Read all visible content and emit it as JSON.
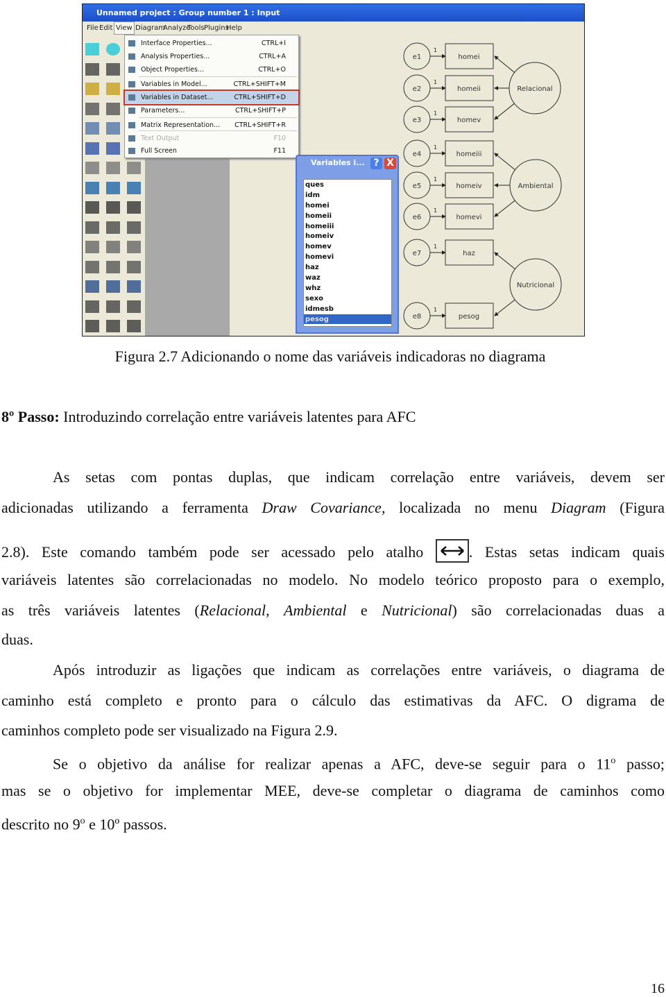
{
  "screenshot": {
    "window_title": "Unnamed project : Group number 1 : Input",
    "menubar": [
      "File",
      "Edit",
      "View",
      "Diagram",
      "Analyze",
      "Tools",
      "Plugins",
      "Help"
    ],
    "active_menu": "View",
    "view_menu": [
      {
        "label": "Interface Properties...",
        "shortcut": "CTRL+I"
      },
      {
        "label": "Analysis Properties...",
        "shortcut": "CTRL+A"
      },
      {
        "label": "Object Properties...",
        "shortcut": "CTRL+O"
      },
      {
        "label": "Variables in Model...",
        "shortcut": "CTRL+SHIFT+M"
      },
      {
        "label": "Variables in Dataset...",
        "shortcut": "CTRL+SHIFT+D",
        "highlighted": true
      },
      {
        "label": "Parameters...",
        "shortcut": "CTRL+SHIFT+P"
      },
      {
        "label": "Matrix Representation...",
        "shortcut": "CTRL+SHIFT+R"
      },
      {
        "label": "Text Output",
        "shortcut": "F10",
        "disabled": true
      },
      {
        "label": "Full Screen",
        "shortcut": "F11"
      }
    ],
    "variables_window": {
      "title": "Variables i...",
      "help": "?",
      "close": "X",
      "items": [
        "ques",
        "idm",
        "homei",
        "homeii",
        "homeiii",
        "homeiv",
        "homev",
        "homevi",
        "haz",
        "waz",
        "whz",
        "sexo",
        "idmesb",
        "pesog"
      ],
      "selected": "pesog"
    },
    "diagram": {
      "errors": [
        "e1",
        "e2",
        "e3",
        "e4",
        "e5",
        "e6",
        "e7",
        "e8"
      ],
      "indicators": [
        "homei",
        "homeii",
        "homev",
        "homeiii",
        "homeiv",
        "homevi",
        "haz",
        "pesog"
      ],
      "latents": [
        "Relacional",
        "Ambiental",
        "Nutricional"
      ],
      "weight_label": "1"
    },
    "colors": {
      "titlebar": "#1d4fc8",
      "highlight_border": "#c0392b",
      "selection": "#3168c8"
    }
  },
  "caption": "Figura 2.7 Adicionando o nome das variáveis indicadoras no diagrama",
  "lines": [
    {
      "segs": [
        {
          "t": "8º Passo:",
          "b": true
        },
        {
          "t": " Introduzindo correlação entre variáveis latentes para AFC"
        }
      ]
    },
    {
      "segs": [
        {
          "t": "As setas com pontas duplas, que indicam correlação entre variáveis, devem ser"
        }
      ]
    },
    {
      "segs": [
        {
          "t": "adicionadas utilizando a ferramenta "
        },
        {
          "t": "Draw Covariance",
          "i": true
        },
        {
          "t": ", localizada no menu "
        },
        {
          "t": "Diagram",
          "i": true
        },
        {
          "t": " (Figura"
        }
      ]
    },
    {
      "segs": [
        {
          "t": "2.8). Este comando também pode ser acessado pelo atalho "
        },
        {
          "icon": "double-arrow-icon"
        },
        {
          "t": ". Estas setas indicam quais"
        }
      ]
    },
    {
      "segs": [
        {
          "t": "variáveis latentes são correlacionadas no modelo. No modelo teórico proposto para o exemplo,"
        }
      ]
    },
    {
      "segs": [
        {
          "t": "as três variáveis latentes ("
        },
        {
          "t": "Relacional",
          "i": true
        },
        {
          "t": ", "
        },
        {
          "t": "Ambiental",
          "i": true
        },
        {
          "t": " e "
        },
        {
          "t": "Nutricional",
          "i": true
        },
        {
          "t": ") são correlacionadas duas a"
        }
      ]
    },
    {
      "segs": [
        {
          "t": "duas."
        }
      ]
    },
    {
      "segs": [
        {
          "t": "Após introduzir as ligações que indicam as correlações entre variáveis, o diagrama de"
        }
      ]
    },
    {
      "segs": [
        {
          "t": "caminho está completo e pronto para o cálculo das estimativas da AFC. O digrama de"
        }
      ]
    },
    {
      "segs": [
        {
          "t": "caminhos completo pode ser visualizado na Figura 2.9."
        }
      ]
    },
    {
      "segs": [
        {
          "t": "Se o objetivo da análise for realizar apenas a AFC, deve-se seguir para o 11"
        },
        {
          "t": "o",
          "sup": true
        },
        {
          "t": " passo;"
        }
      ]
    },
    {
      "segs": [
        {
          "t": "mas se o objetivo for implementar MEE, deve-se completar o diagrama de caminhos como"
        }
      ]
    },
    {
      "segs": [
        {
          "t": "descrito no  9"
        },
        {
          "t": "o",
          "sup": true
        },
        {
          "t": "  e  10º passos."
        }
      ]
    }
  ],
  "page_number": "16"
}
